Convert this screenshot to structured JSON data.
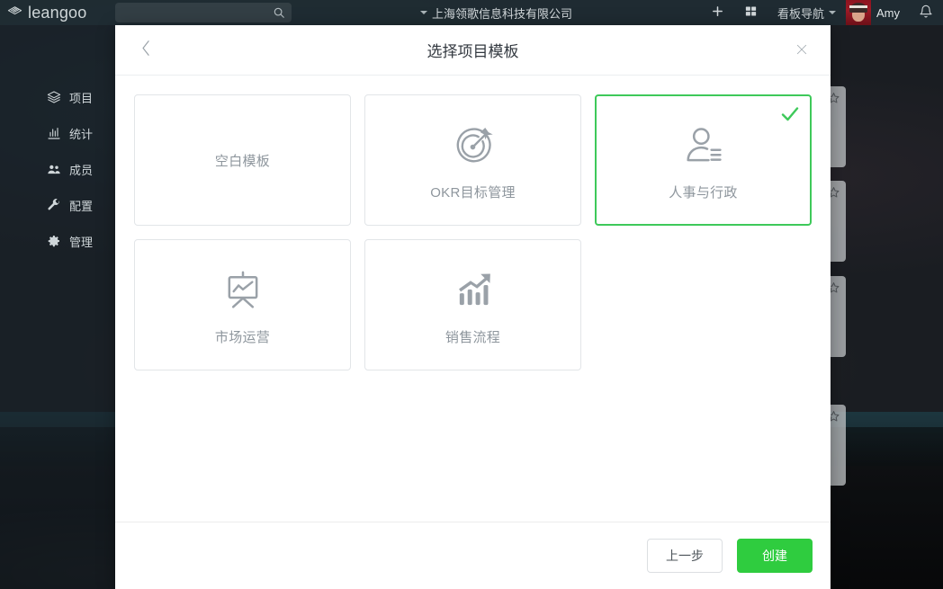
{
  "header": {
    "logo_text": "leangoo",
    "logo_icon": "layers-logo-icon",
    "search_placeholder": "",
    "search_value": "",
    "search_icon": "search-icon",
    "org_name": "上海领歌信息科技有限公司",
    "org_caret_icon": "caret-down-icon",
    "add_icon": "plus-icon",
    "grid_icon": "grid-icon",
    "nav_label": "看板导航",
    "nav_caret_icon": "caret-down-icon",
    "user_name": "Amy",
    "avatar_icon": "user-avatar",
    "bell_icon": "bell-icon"
  },
  "sidebar": {
    "items": [
      {
        "label": "项目",
        "icon": "layers-icon"
      },
      {
        "label": "统计",
        "icon": "bar-chart-icon"
      },
      {
        "label": "成员",
        "icon": "users-icon"
      },
      {
        "label": "配置",
        "icon": "wrench-icon"
      },
      {
        "label": "管理",
        "icon": "gear-icon"
      }
    ]
  },
  "background_boards": [
    {
      "star_icon": "star-outline-icon"
    },
    {
      "star_icon": "star-outline-icon"
    },
    {
      "star_icon": "star-outline-icon"
    },
    {
      "star_icon": "star-outline-icon"
    }
  ],
  "modal": {
    "title": "选择项目模板",
    "back_icon": "chevron-left-icon",
    "close_icon": "close-icon",
    "templates": [
      {
        "label": "空白模板",
        "icon": "none",
        "selected": false
      },
      {
        "label": "OKR目标管理",
        "icon": "target-arrow-icon",
        "selected": false
      },
      {
        "label": "人事与行政",
        "icon": "person-list-icon",
        "selected": true
      },
      {
        "label": "市场运营",
        "icon": "presentation-chart-icon",
        "selected": false
      },
      {
        "label": "销售流程",
        "icon": "growth-arrow-icon",
        "selected": false
      }
    ],
    "selected_check_icon": "check-icon",
    "footer": {
      "prev_label": "上一步",
      "create_label": "创建"
    }
  },
  "colors": {
    "accent_green": "#2fcc3f",
    "selected_border": "#3ec95a",
    "header_bg": "#202d34",
    "icon_gray": "#8e969d"
  }
}
